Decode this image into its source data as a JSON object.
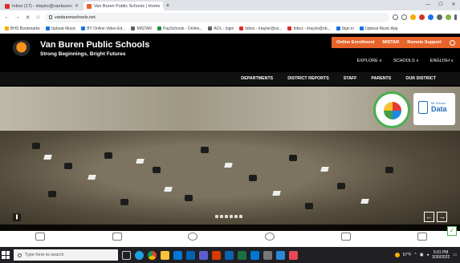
{
  "browser": {
    "tabs": [
      {
        "label": "Inbox (17) - irtaylor@vanburen",
        "favicon_color": "#d93025",
        "active": false
      },
      {
        "label": "Van Buren Public Schools | Home",
        "favicon_color": "#e8632a",
        "active": true
      }
    ],
    "new_tab_label": "+",
    "address": "vanburenschools.net",
    "bookmarks": [
      {
        "label": "BHS Bookmarks",
        "color": "#f9ab00"
      },
      {
        "label": "Upbeat Music",
        "color": "#1a73e8"
      },
      {
        "label": "BY Online Video Ed...",
        "color": "#1a73e8"
      },
      {
        "label": "MISTAR",
        "color": "#5f6368"
      },
      {
        "label": "PaySchools - Online...",
        "color": "#1e8e3e"
      },
      {
        "label": "AOL - login",
        "color": "#5f6368"
      },
      {
        "label": "Inbox - irtaylor@va...",
        "color": "#d93025"
      },
      {
        "label": "Inbox - irtaylor@vb...",
        "color": "#d93025"
      },
      {
        "label": "Sign in",
        "color": "#1a73e8"
      },
      {
        "label": "Upbeat Music App",
        "color": "#1a73e8"
      }
    ]
  },
  "site": {
    "title": "Van Buren Public Schools",
    "tagline": "Strong Beginnings, Bright Futures",
    "utility_links": [
      "Online Enrollment",
      "MISTAR",
      "Remote Support"
    ],
    "mid_nav": [
      "EXPLORE",
      "SCHOOLS",
      "ENGLISH"
    ],
    "main_nav": [
      "DEPARTMENTS",
      "DISTRICT REPORTS",
      "STAFF",
      "PARENTS",
      "OUR DISTRICT"
    ],
    "hero": {
      "badge_data_small": "MI School",
      "badge_data_big": "Data",
      "prev_label": "←",
      "next_label": "→",
      "pause_label": "❚"
    }
  },
  "taskbar": {
    "search_placeholder": "Type here to search",
    "weather": "57°F",
    "time": "5:01 PM",
    "date": "3/30/2022"
  },
  "colors": {
    "accent": "#e8632a",
    "header_bg": "#000000"
  }
}
